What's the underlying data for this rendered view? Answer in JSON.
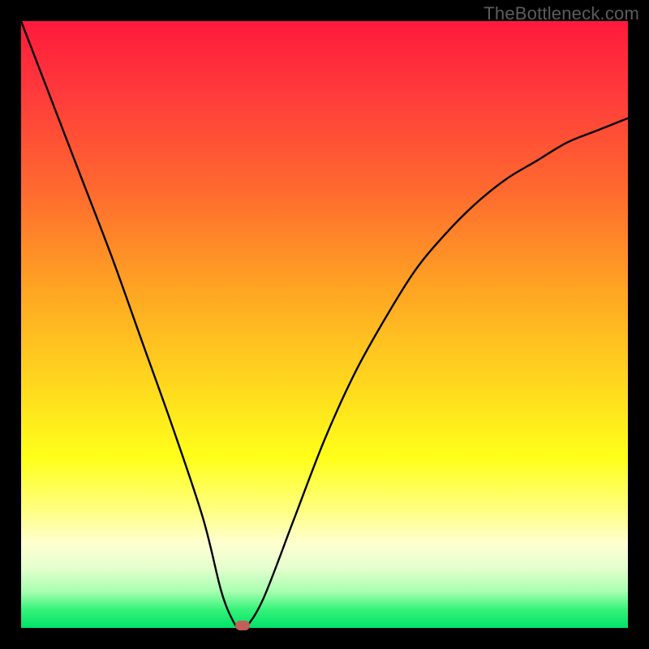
{
  "watermark": "TheBottleneck.com",
  "chart_data": {
    "type": "line",
    "title": "",
    "xlabel": "",
    "ylabel": "",
    "xlim": [
      0,
      100
    ],
    "ylim": [
      0,
      100
    ],
    "series": [
      {
        "name": "curve",
        "x": [
          0,
          5,
          10,
          15,
          20,
          25,
          30,
          33,
          35,
          36,
          37,
          40,
          45,
          50,
          55,
          60,
          65,
          70,
          75,
          80,
          85,
          90,
          95,
          100
        ],
        "y": [
          100,
          87,
          74,
          61,
          47,
          33,
          18,
          6,
          1,
          0,
          0,
          5,
          18,
          31,
          42,
          51,
          59,
          65,
          70,
          74,
          77,
          80,
          82,
          84
        ]
      }
    ],
    "marker": {
      "x": 36.5,
      "y": 0
    },
    "gradient_stops": [
      {
        "pos": 0,
        "color": "#ff1a3c"
      },
      {
        "pos": 50,
        "color": "#ffd21f"
      },
      {
        "pos": 80,
        "color": "#ffff7a"
      },
      {
        "pos": 100,
        "color": "#00e268"
      }
    ]
  }
}
